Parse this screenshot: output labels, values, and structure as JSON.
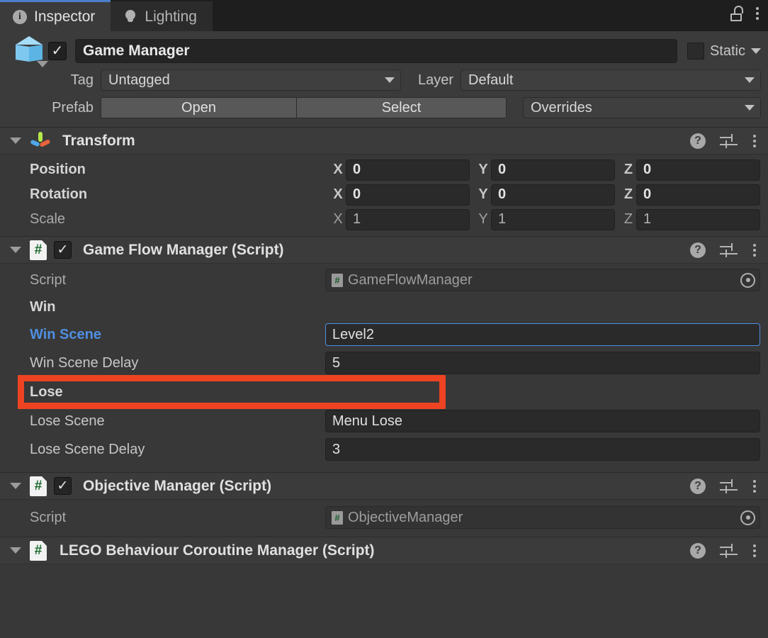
{
  "window": {
    "tabs": [
      {
        "label": "Inspector",
        "icon": "info-icon",
        "active": true
      },
      {
        "label": "Lighting",
        "icon": "lightbulb-icon",
        "active": false
      }
    ],
    "lock_icon": "unlock-icon",
    "menu_icon": "kebab-menu-icon"
  },
  "object_header": {
    "enabled_checkmark": "✓",
    "name": "Game Manager",
    "static_label": "Static",
    "tag_label": "Tag",
    "tag_value": "Untagged",
    "layer_label": "Layer",
    "layer_value": "Default",
    "prefab_label": "Prefab",
    "open_button": "Open",
    "select_button": "Select",
    "overrides_button": "Overrides"
  },
  "components": [
    {
      "title": "Transform",
      "icon": "transform-axis-icon",
      "has_checkbox": false,
      "rows": [
        {
          "name": "Position",
          "bold": true,
          "x": "0",
          "y": "0",
          "z": "0"
        },
        {
          "name": "Rotation",
          "bold": true,
          "x": "0",
          "y": "0",
          "z": "0"
        },
        {
          "name": "Scale",
          "bold": false,
          "x": "1",
          "y": "1",
          "z": "1"
        }
      ],
      "axis_labels": {
        "x": "X",
        "y": "Y",
        "z": "Z"
      }
    },
    {
      "title": "Game Flow Manager (Script)",
      "icon": "csharp-script-icon",
      "has_checkbox": true,
      "script_label": "Script",
      "script_value": "GameFlowManager",
      "sections": [
        {
          "header": "Win",
          "fields": [
            {
              "label": "Win Scene",
              "value": "Level2",
              "selected": true,
              "focused": true,
              "overridden": true
            },
            {
              "label": "Win Scene Delay",
              "value": "5",
              "selected": false,
              "focused": false,
              "overridden": false
            }
          ]
        },
        {
          "header": "Lose",
          "fields": [
            {
              "label": "Lose Scene",
              "value": "Menu Lose",
              "selected": false,
              "focused": false,
              "overridden": false
            },
            {
              "label": "Lose Scene Delay",
              "value": "3",
              "selected": false,
              "focused": false,
              "overridden": false
            }
          ]
        }
      ]
    },
    {
      "title": "Objective Manager (Script)",
      "icon": "csharp-script-icon",
      "has_checkbox": true,
      "script_label": "Script",
      "script_value": "ObjectiveManager"
    },
    {
      "title": "LEGO Behaviour Coroutine Manager (Script)",
      "icon": "csharp-script-icon",
      "has_checkbox": false
    }
  ],
  "header_icons": {
    "help": "?",
    "preset": "preset-icon",
    "menu": "kebab-menu-icon"
  },
  "annotation": {
    "color": "#ee4322",
    "target": "Win Scene row"
  },
  "colors": {
    "accent_blue": "#4f8fe0",
    "annotation_red": "#ee4322",
    "panel_bg": "#383838",
    "header_bg": "#3b3b3b",
    "field_bg": "#2a2a2a"
  }
}
